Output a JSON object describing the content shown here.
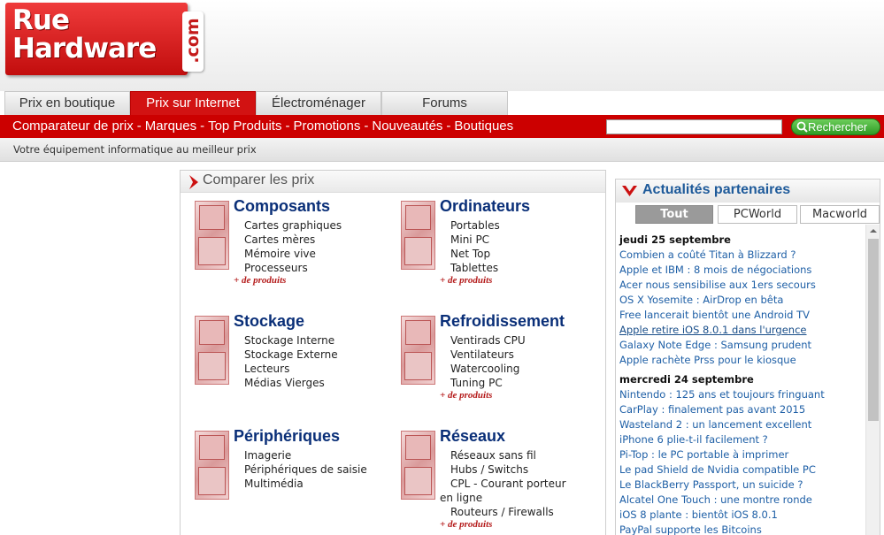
{
  "logo": {
    "line1": "Rue",
    "line2": "Hardware",
    "tld": ".com"
  },
  "tabs": [
    {
      "label": "Prix en boutique",
      "active": false
    },
    {
      "label": "Prix sur Internet",
      "active": true
    },
    {
      "label": "Électroménager",
      "active": false
    },
    {
      "label": "Forums",
      "active": false
    }
  ],
  "nav": {
    "links": [
      "Comparateur de prix",
      "Marques",
      "Top Produits",
      "Promotions",
      "Nouveautés",
      "Boutiques"
    ],
    "separator": "-",
    "search_value": "",
    "search_button": "Rechercher"
  },
  "tagline": "Votre équipement informatique au meilleur prix",
  "compare": {
    "title": "Comparer les prix",
    "more_label": "+ de produits",
    "categories": [
      {
        "title": "Composants",
        "items": [
          "Cartes graphiques",
          "Cartes mères",
          "Mémoire vive",
          "Processeurs"
        ]
      },
      {
        "title": "Ordinateurs",
        "items": [
          "Portables",
          "Mini PC",
          "Net Top",
          "Tablettes"
        ]
      },
      {
        "title": "Stockage",
        "items": [
          "Stockage Interne",
          "Stockage Externe",
          "Lecteurs",
          "Médias Vierges"
        ]
      },
      {
        "title": "Refroidissement",
        "items": [
          "Ventirads CPU",
          "Ventilateurs",
          "Watercooling",
          "Tuning PC"
        ]
      },
      {
        "title": "Périphériques",
        "items": [
          "Imagerie",
          "Périphériques de saisie",
          "Multimédia"
        ]
      },
      {
        "title": "Réseaux",
        "items": [
          "Réseaux sans fil",
          "Hubs / Switchs",
          "CPL - Courant porteur en ligne",
          "Routeurs / Firewalls"
        ]
      }
    ]
  },
  "news": {
    "title": "Actualités partenaires",
    "tabs": [
      {
        "label": "Tout",
        "active": true
      },
      {
        "label": "PCWorld",
        "active": false
      },
      {
        "label": "Macworld",
        "active": false
      }
    ],
    "days": [
      {
        "date": "jeudi 25 septembre",
        "items": [
          "Combien a coûté Titan à Blizzard ?",
          "Apple et IBM : 8 mois de négociations",
          "Acer nous sensibilise aux 1ers secours",
          "OS X Yosemite : AirDrop en bêta",
          "Free lancerait bientôt une Android TV",
          "Apple retire iOS 8.0.1 dans l'urgence",
          "Galaxy Note Edge : Samsung prudent",
          "Apple rachète Prss pour le kiosque"
        ]
      },
      {
        "date": "mercredi 24 septembre",
        "items": [
          "Nintendo : 125 ans et toujours fringuant",
          "CarPlay : finalement pas avant 2015",
          "Wasteland 2 : un lancement excellent",
          "iPhone 6 plie-t-il facilement ?",
          "Pi-Top : le PC portable à imprimer",
          "Le pad Shield de Nvidia compatible PC",
          "Le BlackBerry Passport, un suicide ?",
          "Alcatel One Touch : une montre ronde",
          "iOS 8 plante : bientôt iOS 8.0.1",
          "PayPal supporte les Bitcoins"
        ]
      }
    ],
    "hovered_item": "Apple retire iOS 8.0.1 dans l'urgence"
  },
  "colors": {
    "brand_red": "#cc0000",
    "link_blue": "#1e5fa6",
    "title_navy": "#0a2f78",
    "search_green": "#2f9a24"
  },
  "icons": [
    "search-icon",
    "arrow-right-icon",
    "chevron-down-icon",
    "scroll-up-icon"
  ]
}
